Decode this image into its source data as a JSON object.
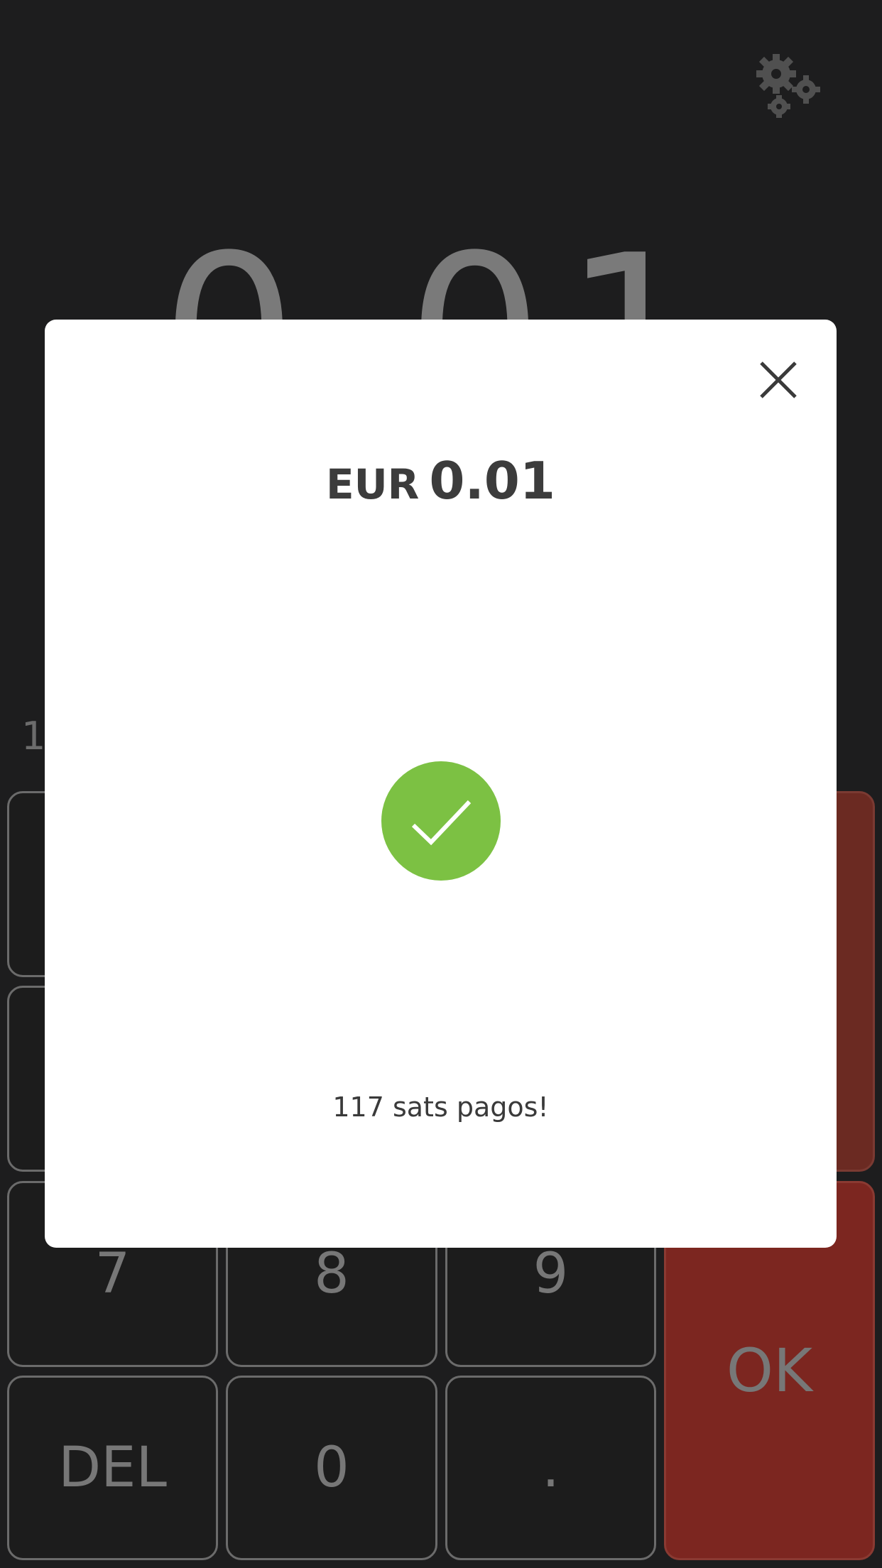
{
  "display": {
    "amount": "0.01",
    "fiat_line": "1"
  },
  "keypad": {
    "keys": {
      "seven": "7",
      "eight": "8",
      "nine": "9",
      "del": "DEL",
      "zero": "0",
      "dot": ".",
      "ok": "OK"
    }
  },
  "modal": {
    "currency": "EUR",
    "amount": "0.01",
    "message": "117 sats pagos!"
  },
  "icons": {
    "settings": "gear-icon",
    "close": "close-icon",
    "success": "checkmark-icon"
  },
  "colors": {
    "background": "#1d1d1e",
    "ok_key": "#7c2620",
    "success": "#7cc143"
  }
}
